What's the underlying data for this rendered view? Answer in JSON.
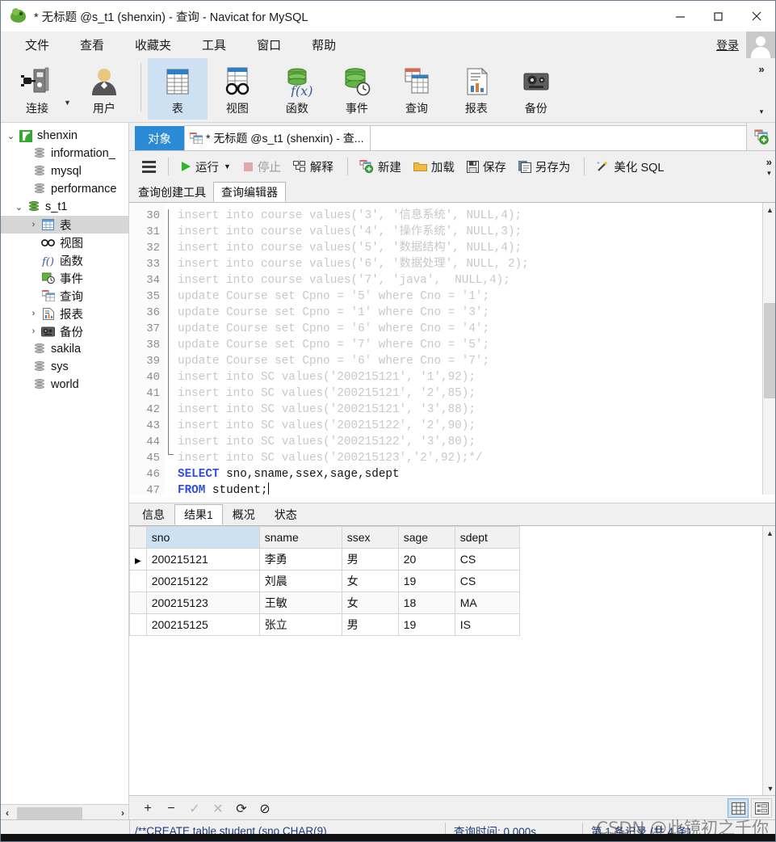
{
  "window": {
    "title": "* 无标题 @s_t1 (shenxin) - 查询 - Navicat for MySQL",
    "minimize": "—",
    "maximize": "☐",
    "close": "✕"
  },
  "menubar": {
    "items": [
      {
        "label": "文件"
      },
      {
        "label": "查看"
      },
      {
        "label": "收藏夹"
      },
      {
        "label": "工具"
      },
      {
        "label": "窗口"
      },
      {
        "label": "帮助"
      }
    ],
    "login_label": "登录"
  },
  "toolbar": {
    "items": [
      {
        "label": "连接",
        "icon": "connection-icon",
        "active": false
      },
      {
        "label": "用户",
        "icon": "user-icon",
        "active": false
      },
      {
        "label": "表",
        "icon": "table-icon",
        "active": true
      },
      {
        "label": "视图",
        "icon": "view-icon",
        "active": false
      },
      {
        "label": "函数",
        "icon": "function-icon",
        "active": false
      },
      {
        "label": "事件",
        "icon": "event-icon",
        "active": false
      },
      {
        "label": "查询",
        "icon": "query-icon",
        "active": false
      },
      {
        "label": "报表",
        "icon": "report-icon",
        "active": false
      },
      {
        "label": "备份",
        "icon": "backup-icon",
        "active": false
      }
    ],
    "overflow": "»",
    "overflow_down": "▾"
  },
  "sidebar": {
    "nodes": [
      {
        "label": "shenxin",
        "icon": "connection-icon",
        "depth": 0,
        "twisty": "⌄",
        "selected": false
      },
      {
        "label": "information_",
        "icon": "database-icon",
        "depth": 1,
        "twisty": "",
        "selected": false
      },
      {
        "label": "mysql",
        "icon": "database-icon",
        "depth": 1,
        "twisty": "",
        "selected": false
      },
      {
        "label": "performance",
        "icon": "database-icon",
        "depth": 1,
        "twisty": "",
        "selected": false
      },
      {
        "label": "s_t1",
        "icon": "database-open-icon",
        "depth": 1,
        "twisty": "⌄",
        "selected": false
      },
      {
        "label": "表",
        "icon": "table-icon",
        "depth": 2,
        "twisty": "›",
        "selected": true
      },
      {
        "label": "视图",
        "icon": "view-icon",
        "depth": 2,
        "twisty": "",
        "selected": false
      },
      {
        "label": "函数",
        "icon": "function-icon",
        "depth": 2,
        "twisty": "",
        "selected": false
      },
      {
        "label": "事件",
        "icon": "event-icon",
        "depth": 2,
        "twisty": "",
        "selected": false
      },
      {
        "label": "查询",
        "icon": "query-icon",
        "depth": 2,
        "twisty": "",
        "selected": false
      },
      {
        "label": "报表",
        "icon": "report-icon",
        "depth": 2,
        "twisty": "›",
        "selected": false
      },
      {
        "label": "备份",
        "icon": "backup-icon",
        "depth": 2,
        "twisty": "›",
        "selected": false
      },
      {
        "label": "sakila",
        "icon": "database-icon",
        "depth": 1,
        "twisty": "",
        "selected": false
      },
      {
        "label": "sys",
        "icon": "database-icon",
        "depth": 1,
        "twisty": "",
        "selected": false
      },
      {
        "label": "world",
        "icon": "database-icon",
        "depth": 1,
        "twisty": "",
        "selected": false
      }
    ],
    "scroll_left": "‹",
    "scroll_right": "›"
  },
  "tabs": {
    "object_tab": "对象",
    "query_tab": "* 无标题 @s_t1 (shenxin) - 查...",
    "new_tab_icon": "new-tab-icon"
  },
  "query_toolbar": {
    "menu_icon": "hamburger-icon",
    "buttons": [
      {
        "label": "运行",
        "icon": "play-icon",
        "disabled": false,
        "has_caret": true
      },
      {
        "label": "停止",
        "icon": "stop-icon",
        "disabled": true,
        "has_caret": false
      },
      {
        "label": "解释",
        "icon": "explain-icon",
        "disabled": false,
        "has_caret": false
      },
      {
        "label": "新建",
        "icon": "new-query-icon",
        "disabled": false,
        "has_caret": false
      },
      {
        "label": "加载",
        "icon": "folder-icon",
        "disabled": false,
        "has_caret": false
      },
      {
        "label": "保存",
        "icon": "save-icon",
        "disabled": false,
        "has_caret": false
      },
      {
        "label": "另存为",
        "icon": "save-as-icon",
        "disabled": false,
        "has_caret": false
      },
      {
        "label": "美化 SQL",
        "icon": "beautify-icon",
        "disabled": false,
        "has_caret": false
      }
    ],
    "overflow": "»",
    "overflow_down": "▾"
  },
  "sub_tabs": [
    {
      "label": "查询创建工具",
      "active": false
    },
    {
      "label": "查询编辑器",
      "active": true
    }
  ],
  "editor": {
    "first_line_number": 30,
    "lines": [
      {
        "n": 30,
        "text": "insert into course values('3', '信息系统', NULL,4);",
        "style": "comment"
      },
      {
        "n": 31,
        "text": "insert into course values('4', '操作系统', NULL,3);",
        "style": "comment"
      },
      {
        "n": 32,
        "text": "insert into course values('5', '数据结构', NULL,4);",
        "style": "comment"
      },
      {
        "n": 33,
        "text": "insert into course values('6', '数据处理', NULL, 2);",
        "style": "comment"
      },
      {
        "n": 34,
        "text": "insert into course values('7', 'java',  NULL,4);",
        "style": "comment"
      },
      {
        "n": 35,
        "text": "update Course set Cpno = '5' where Cno = '1';",
        "style": "comment"
      },
      {
        "n": 36,
        "text": "update Course set Cpno = '1' where Cno = '3';",
        "style": "comment"
      },
      {
        "n": 37,
        "text": "update Course set Cpno = '6' where Cno = '4';",
        "style": "comment"
      },
      {
        "n": 38,
        "text": "update Course set Cpno = '7' where Cno = '5';",
        "style": "comment"
      },
      {
        "n": 39,
        "text": "update Course set Cpno = '6' where Cno = '7';",
        "style": "comment"
      },
      {
        "n": 40,
        "text": "insert into SC values('200215121', '1',92);",
        "style": "comment"
      },
      {
        "n": 41,
        "text": "insert into SC values('200215121', '2',85);",
        "style": "comment"
      },
      {
        "n": 42,
        "text": "insert into SC values('200215121', '3',88);",
        "style": "comment"
      },
      {
        "n": 43,
        "text": "insert into SC values('200215122', '2',90);",
        "style": "comment"
      },
      {
        "n": 44,
        "text": "insert into SC values('200215122', '3',80);",
        "style": "comment"
      },
      {
        "n": 45,
        "text": "insert into SC values('200215123','2',92);*/",
        "style": "comment"
      },
      {
        "n": 46,
        "text": "SELECT sno,sname,ssex,sage,sdept",
        "style": "sql",
        "keyword": "SELECT",
        "rest": " sno,sname,ssex,sage,sdept"
      },
      {
        "n": 47,
        "text": "FROM student;",
        "style": "sql",
        "keyword": "FROM",
        "rest": " student;"
      },
      {
        "n": 48,
        "text": "",
        "style": "plain"
      }
    ]
  },
  "result_tabs": [
    {
      "label": "信息",
      "active": false
    },
    {
      "label": "结果1",
      "active": true
    },
    {
      "label": "概况",
      "active": false
    },
    {
      "label": "状态",
      "active": false
    }
  ],
  "result_grid": {
    "columns": [
      "sno",
      "sname",
      "ssex",
      "sage",
      "sdept"
    ],
    "selected_column": "sno",
    "current_row_index": 0,
    "rows": [
      {
        "sno": "200215121",
        "sname": "李勇",
        "ssex": "男",
        "sage": "20",
        "sdept": "CS"
      },
      {
        "sno": "200215122",
        "sname": "刘晨",
        "ssex": "女",
        "sage": "19",
        "sdept": "CS"
      },
      {
        "sno": "200215123",
        "sname": "王敏",
        "ssex": "女",
        "sage": "18",
        "sdept": "MA"
      },
      {
        "sno": "200215125",
        "sname": "张立",
        "ssex": "男",
        "sage": "19",
        "sdept": "IS"
      }
    ]
  },
  "grid_footer": {
    "buttons": [
      {
        "icon": "plus-icon",
        "label": "+",
        "disabled": false
      },
      {
        "icon": "minus-icon",
        "label": "−",
        "disabled": false
      },
      {
        "icon": "check-icon",
        "label": "✓",
        "disabled": true
      },
      {
        "icon": "cancel-icon",
        "label": "✕",
        "disabled": true
      },
      {
        "icon": "refresh-icon",
        "label": "⟳",
        "disabled": false
      },
      {
        "icon": "stop-circle-icon",
        "label": "⊘",
        "disabled": false
      }
    ],
    "grid_view_icon": "grid-view-icon",
    "form_view_icon": "form-view-icon"
  },
  "statusbar": {
    "sql_text": "/**CREATE table student (sno CHAR(9)",
    "query_time": "查询时间: 0.000s",
    "record_info": "第 1 条记录 (共 4 条)",
    "watermark": "CSDN @此镜初之千你"
  }
}
